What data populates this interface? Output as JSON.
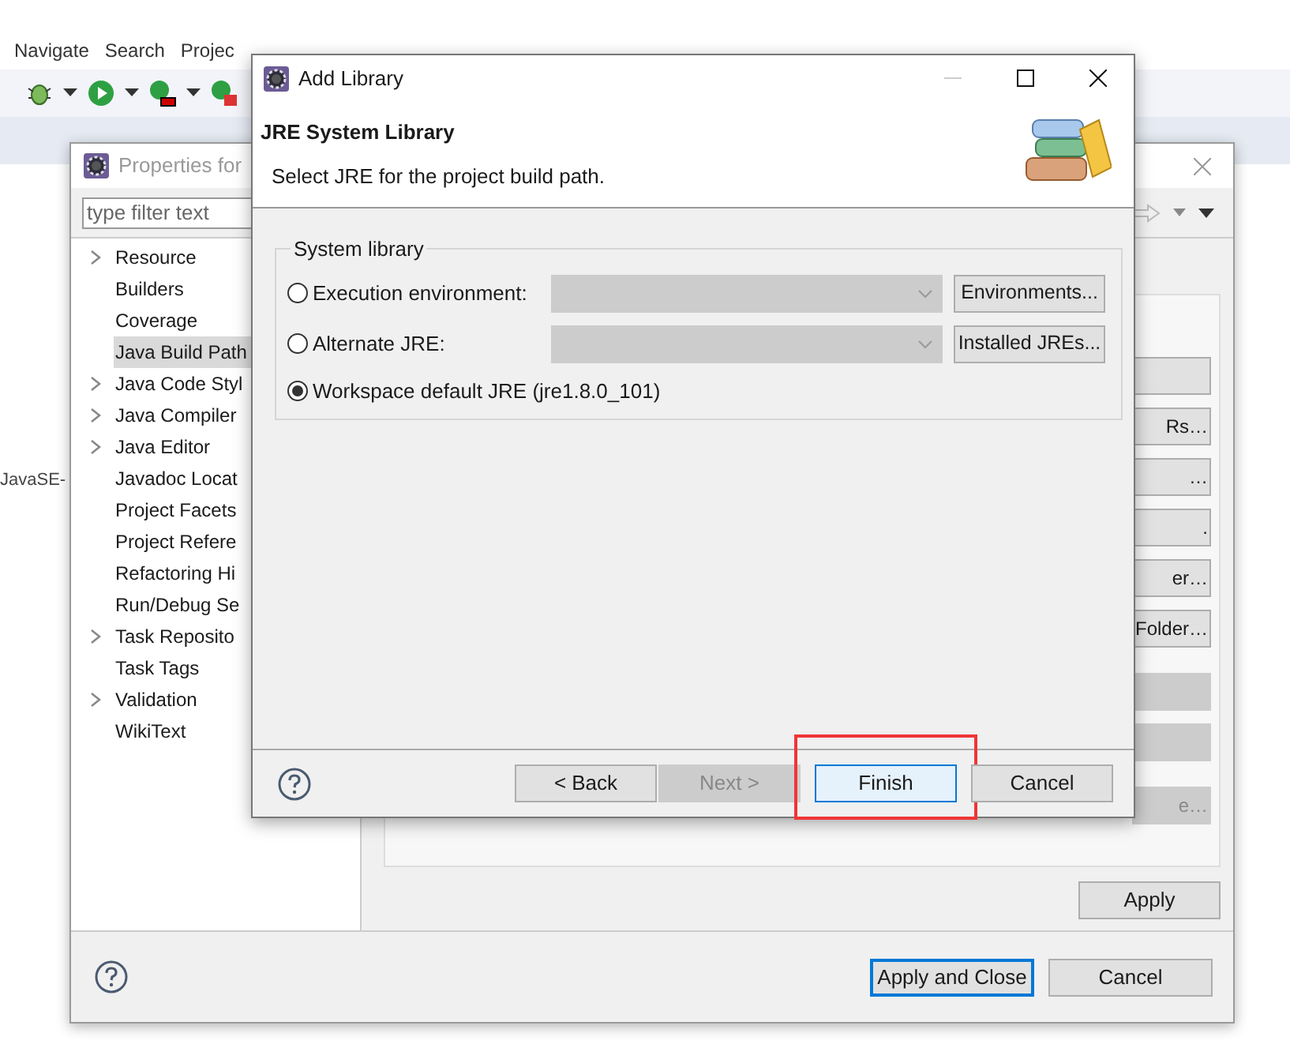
{
  "ide": {
    "menu": [
      "Navigate",
      "Search",
      "Projec"
    ],
    "editor_label": "JavaSE-"
  },
  "properties": {
    "title": "Properties for",
    "filter": {
      "placeholder": "type filter text"
    },
    "tree": [
      {
        "label": "Resource",
        "expandable": true,
        "selected": false
      },
      {
        "label": "Builders",
        "expandable": false,
        "selected": false
      },
      {
        "label": "Coverage",
        "expandable": false,
        "selected": false
      },
      {
        "label": "Java Build Path",
        "expandable": false,
        "selected": true
      },
      {
        "label": "Java Code Styl",
        "expandable": true,
        "selected": false
      },
      {
        "label": "Java Compiler",
        "expandable": true,
        "selected": false
      },
      {
        "label": "Java Editor",
        "expandable": true,
        "selected": false
      },
      {
        "label": "Javadoc Locat",
        "expandable": false,
        "selected": false
      },
      {
        "label": "Project Facets",
        "expandable": false,
        "selected": false
      },
      {
        "label": "Project Refere",
        "expandable": false,
        "selected": false
      },
      {
        "label": "Refactoring Hi",
        "expandable": false,
        "selected": false
      },
      {
        "label": "Run/Debug Se",
        "expandable": false,
        "selected": false
      },
      {
        "label": "Task Reposito",
        "expandable": true,
        "selected": false
      },
      {
        "label": "Task Tags",
        "expandable": false,
        "selected": false
      },
      {
        "label": "Validation",
        "expandable": true,
        "selected": false
      },
      {
        "label": "WikiText",
        "expandable": false,
        "selected": false
      }
    ],
    "side_buttons": [
      {
        "disabled": false
      },
      {
        "label": "Rs…",
        "disabled": false
      },
      {
        "label": "…",
        "disabled": false
      },
      {
        "label": ".",
        "disabled": false
      },
      {
        "label": "er…",
        "disabled": false
      },
      {
        "label": "Folder…",
        "disabled": false
      },
      {
        "disabled": true
      },
      {
        "disabled": true
      },
      {
        "label": "e…",
        "disabled": true
      }
    ],
    "apply": "Apply",
    "buttons": [
      {
        "label": "Apply and Close",
        "default": true
      },
      {
        "label": "Cancel",
        "default": false
      }
    ]
  },
  "add_library": {
    "title": "Add Library",
    "heading": "JRE System Library",
    "description": "Select JRE for the project build path.",
    "group": "System library",
    "options": [
      {
        "kind": "combo",
        "label": "Execution environment:",
        "selected": false,
        "button": "Environments..."
      },
      {
        "kind": "combo",
        "label": "Alternate JRE:",
        "selected": false,
        "button": "Installed JREs..."
      },
      {
        "kind": "plain",
        "label": "Workspace default JRE (jre1.8.0_101)",
        "selected": true
      }
    ],
    "buttons": [
      {
        "label": "< Back",
        "disabled": false,
        "default": false,
        "highlighted": false
      },
      {
        "label": "Next >",
        "disabled": true,
        "default": false,
        "highlighted": false
      },
      {
        "label": "Finish",
        "disabled": false,
        "default": true,
        "highlighted": true
      },
      {
        "label": "Cancel",
        "disabled": false,
        "default": false,
        "highlighted": false
      }
    ]
  }
}
